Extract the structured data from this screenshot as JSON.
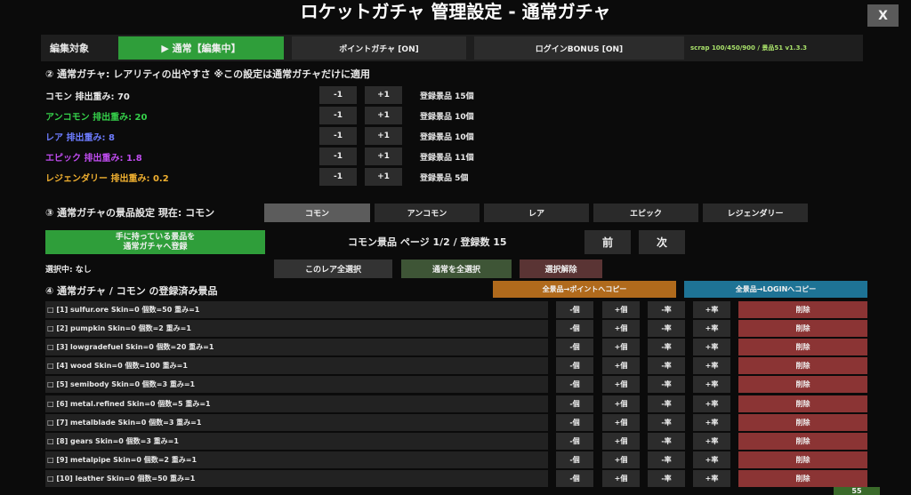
{
  "title": "ロケットガチャ 管理設定 - 通常ガチャ",
  "close_label": "X",
  "top": {
    "edit_target": "編集対象",
    "normal_tab": "▶ 通常【編集中】",
    "point_tab": "ポイントガチャ [ON]",
    "login_tab": "ログインBONUS [ON]",
    "version_info": "scrap 100/450/900 / 景品51  v1.3.3"
  },
  "section2": {
    "heading": "② 通常ガチャ: レアリティの出やすさ ※この設定は通常ガチャだけに適用",
    "minus": "-1",
    "plus": "+1",
    "rarities": [
      {
        "label": "コモン 排出重み: 70",
        "count": "登録景品 15個",
        "color": "#e8e8e8"
      },
      {
        "label": "アンコモン 排出重み: 20",
        "count": "登録景品 10個",
        "color": "#35d04a"
      },
      {
        "label": "レア 排出重み: 8",
        "count": "登録景品 10個",
        "color": "#6d7cff"
      },
      {
        "label": "エピック 排出重み: 1.8",
        "count": "登録景品 11個",
        "color": "#c04cf0"
      },
      {
        "label": "レジェンダリー 排出重み: 0.2",
        "count": "登録景品 5個",
        "color": "#f0b030"
      }
    ]
  },
  "section3": {
    "heading": "③ 通常ガチャの景品設定 現在: コモン",
    "tabs": [
      "コモン",
      "アンコモン",
      "レア",
      "エピック",
      "レジェンダリー"
    ],
    "register_button": [
      "手に持っている景品を",
      "通常ガチャへ登録"
    ],
    "page_info": "コモン景品 ページ 1/2 / 登録数 15",
    "prev": "前",
    "next": "次",
    "selected": "選択中: なし",
    "select_rare_all": "このレア全選択",
    "select_normal_all": "通常を全選択",
    "deselect": "選択解除"
  },
  "section4": {
    "heading": "④ 通常ガチャ / コモン の登録済み景品",
    "copy_point": "全景品→ポイントへコピー",
    "copy_login": "全景品→LOGINへコピー",
    "btn_minus_qty": "-個",
    "btn_plus_qty": "+個",
    "btn_minus_rate": "-率",
    "btn_plus_rate": "+率",
    "btn_delete": "削除",
    "items": [
      "□ [1] sulfur.ore  Skin=0  個数=50  重み=1",
      "□ [2] pumpkin  Skin=0  個数=2  重み=1",
      "□ [3] lowgradefuel  Skin=0  個数=20  重み=1",
      "□ [4] wood  Skin=0  個数=100  重み=1",
      "□ [5] semibody  Skin=0  個数=3  重み=1",
      "□ [6] metal.refined  Skin=0  個数=5  重み=1",
      "□ [7] metalblade  Skin=0  個数=3  重み=1",
      "□ [8] gears  Skin=0  個数=3  重み=1",
      "□ [9] metalpipe  Skin=0  個数=2  重み=1",
      "□ [10] leather  Skin=0  個数=50  重み=1"
    ]
  },
  "corner_badge": "55",
  "colors": {
    "green": "#2f9e3a",
    "orange": "#b06a1c",
    "blue": "#1e7395",
    "delete_red": "#8b3434",
    "select_green": "#3e5536",
    "deselect_red": "#5a3434"
  }
}
